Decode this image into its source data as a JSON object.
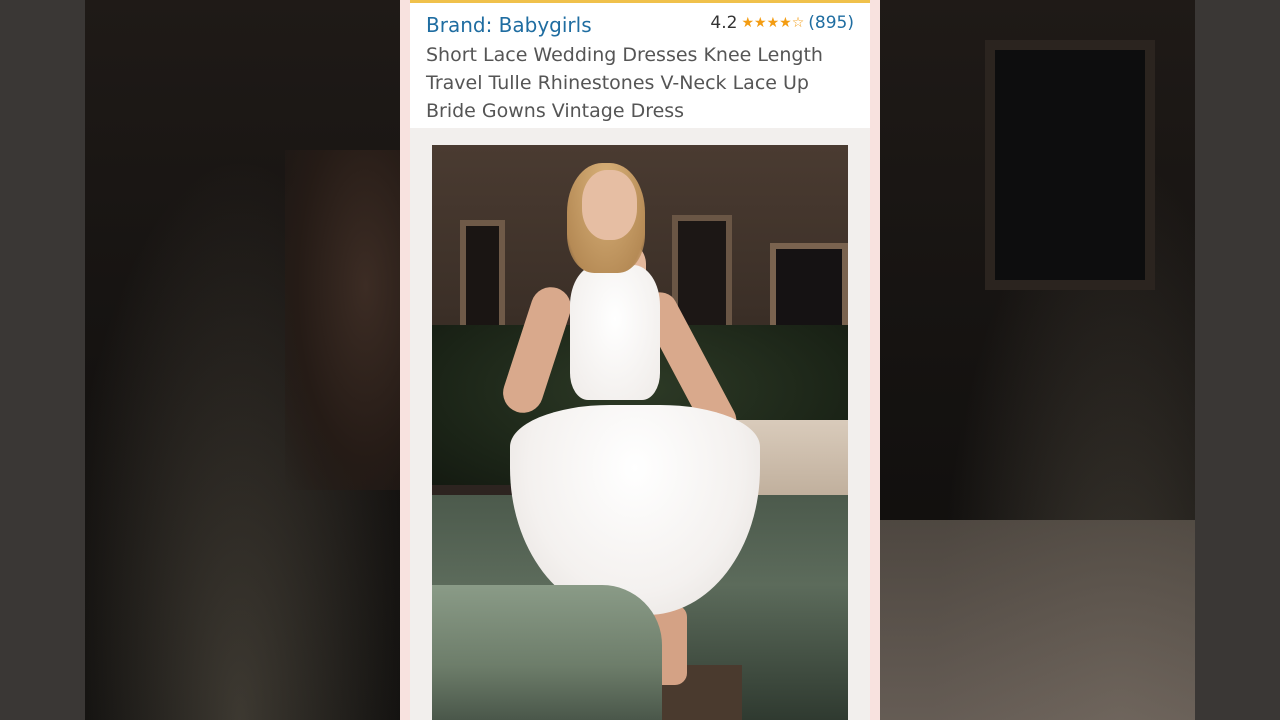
{
  "product": {
    "brand": "Brand: Babygirls",
    "rating_value": "4.2",
    "stars_filled": 4,
    "stars_total": 5,
    "review_count": "(895)",
    "title": "Short Lace Wedding Dresses Knee Length Travel Tulle Rhinestones V-Neck Lace Up Bride Gowns Vintage Dress"
  },
  "icons": {
    "star_filled": "★",
    "star_empty": "☆"
  },
  "colors": {
    "brand_link": "#1f6da1",
    "star": "#f39c12",
    "accent_bar": "#f0c14b"
  }
}
